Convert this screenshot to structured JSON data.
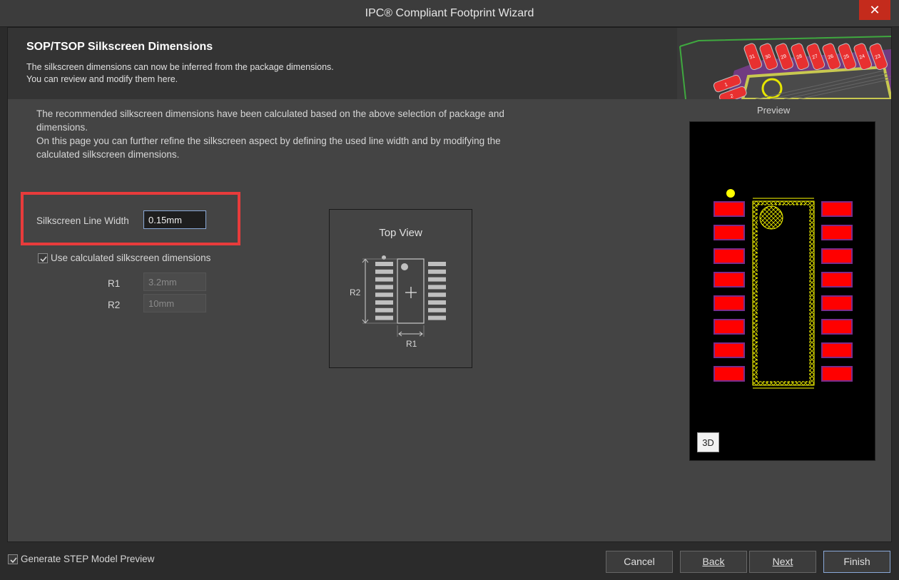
{
  "window": {
    "title": "IPC® Compliant Footprint Wizard",
    "close_glyph": "✕"
  },
  "header": {
    "title": "SOP/TSOP Silkscreen Dimensions",
    "line1": "The silkscreen dimensions can now be inferred from the package dimensions.",
    "line2": "You can review and modify them here.",
    "art_pad_labels": [
      "31",
      "30",
      "29",
      "28",
      "27",
      "26",
      "25",
      "24",
      "23",
      "1",
      "2"
    ]
  },
  "description": {
    "line1": "The recommended silkscreen dimensions have been calculated based on the above selection of package and",
    "line2": "dimensions.",
    "line3": "On this page you can further refine the silkscreen aspect by defining the used line width and by modifying the",
    "line4": "calculated silkscreen dimensions."
  },
  "silkscreen": {
    "line_width_label": "Silkscreen Line Width",
    "line_width_value": "0.15mm",
    "use_calculated_label": "Use calculated silkscreen dimensions",
    "use_calculated_checked": true,
    "r1_label": "R1",
    "r1_value": "3.2mm",
    "r2_label": "R2",
    "r2_value": "10mm"
  },
  "top_view": {
    "title": "Top View",
    "r1_label": "R1",
    "r2_label": "R2"
  },
  "preview": {
    "label": "Preview",
    "button_3d": "3D",
    "pad_rows": 8
  },
  "footer": {
    "generate_step_label": "Generate STEP Model Preview",
    "generate_step_checked": true,
    "cancel": "Cancel",
    "back": "Back",
    "next": "Next",
    "finish": "Finish"
  },
  "colors": {
    "highlight": "#e83b3b",
    "pad_red": "#ff0000",
    "pad_outline": "#7a2c8c",
    "silk_yellow": "#ffff00",
    "primary_border": "#8aa9d8"
  }
}
